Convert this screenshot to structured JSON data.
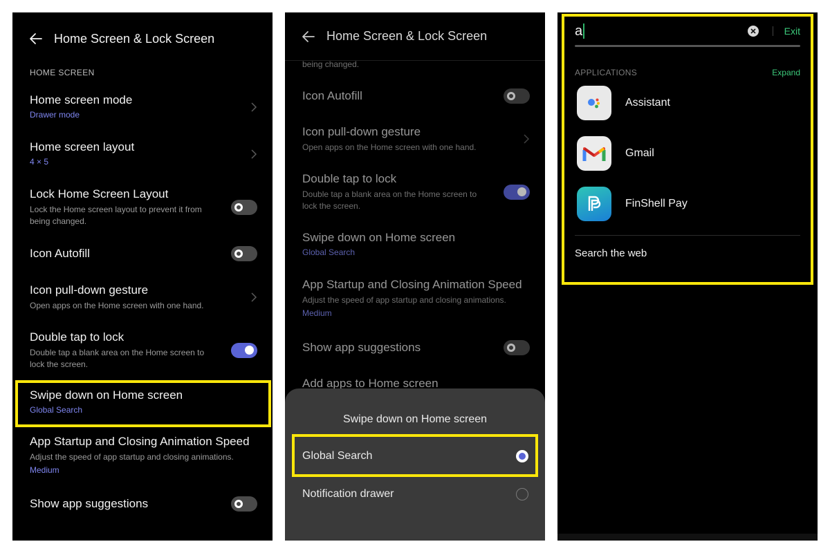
{
  "panel1": {
    "header_title": "Home Screen & Lock Screen",
    "section_label": "HOME SCREEN",
    "items": [
      {
        "title": "Home screen mode",
        "value": "Drawer mode"
      },
      {
        "title": "Home screen layout",
        "value": "4 × 5"
      },
      {
        "title": "Lock Home Screen Layout",
        "subtitle": "Lock the Home screen layout to prevent it from being changed.",
        "toggle": "off"
      },
      {
        "title": "Icon Autofill",
        "toggle": "off"
      },
      {
        "title": "Icon pull-down gesture",
        "subtitle": "Open apps on the Home screen with one hand."
      },
      {
        "title": "Double tap to lock",
        "subtitle": "Double tap a blank area on the Home screen to lock the screen.",
        "toggle": "on"
      },
      {
        "title": "Swipe down on Home screen",
        "value": "Global Search"
      },
      {
        "title": "App Startup and Closing Animation Speed",
        "subtitle": "Adjust the speed of app startup and closing animations.",
        "value": "Medium"
      },
      {
        "title": "Show app suggestions",
        "toggle": "off"
      }
    ]
  },
  "panel2": {
    "header_title": "Home Screen & Lock Screen",
    "partial_text": "being changed.",
    "items": [
      {
        "title": "Icon Autofill",
        "toggle": "off"
      },
      {
        "title": "Icon pull-down gesture",
        "subtitle": "Open apps on the Home screen with one hand."
      },
      {
        "title": "Double tap to lock",
        "subtitle": "Double tap a blank area on the Home screen to lock the screen.",
        "toggle": "on"
      },
      {
        "title": "Swipe down on Home screen",
        "value": "Global Search"
      },
      {
        "title": "App Startup and Closing Animation Speed",
        "subtitle": "Adjust the speed of app startup and closing animations.",
        "value": "Medium"
      },
      {
        "title": "Show app suggestions",
        "toggle": "off"
      },
      {
        "title": "Add apps to Home screen"
      }
    ],
    "sheet": {
      "title": "Swipe down on Home screen",
      "options": [
        {
          "label": "Global Search",
          "selected": true
        },
        {
          "label": "Notification drawer",
          "selected": false
        }
      ]
    }
  },
  "panel3": {
    "search_value": "a",
    "exit_label": "Exit",
    "apps_label": "APPLICATIONS",
    "expand_label": "Expand",
    "apps": [
      {
        "name": "Assistant",
        "icon": "google-assistant-icon"
      },
      {
        "name": "Gmail",
        "icon": "gmail-icon"
      },
      {
        "name": "FinShell Pay",
        "icon": "finshell-pay-icon"
      }
    ],
    "search_web_label": "Search the web"
  },
  "colors": {
    "highlight": "#fbe60b",
    "accent_blue": "#7f86f0",
    "toggle_on": "#5a64d6",
    "accent_green": "#3cc97a"
  }
}
